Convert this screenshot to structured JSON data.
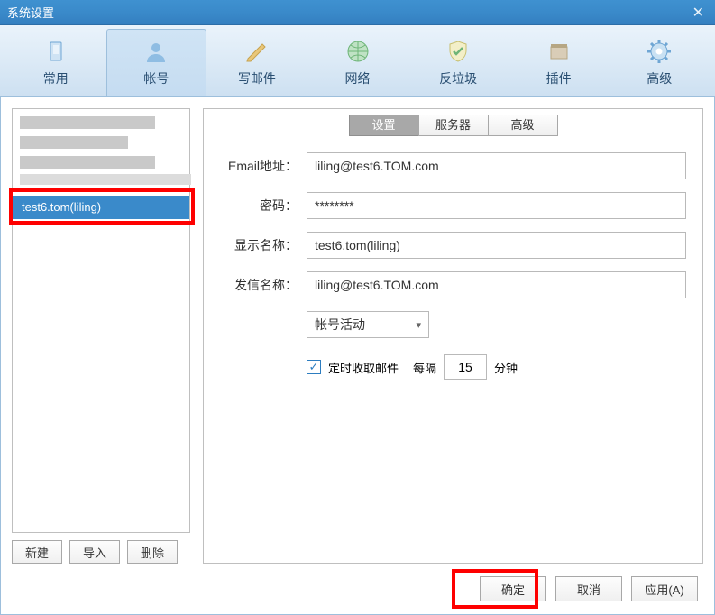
{
  "window": {
    "title": "系统设置"
  },
  "toolbar": {
    "items": [
      {
        "label": "常用",
        "name": "tab-general",
        "active": false
      },
      {
        "label": "帐号",
        "name": "tab-account",
        "active": true
      },
      {
        "label": "写邮件",
        "name": "tab-compose",
        "active": false
      },
      {
        "label": "网络",
        "name": "tab-network",
        "active": false
      },
      {
        "label": "反垃圾",
        "name": "tab-antispam",
        "active": false
      },
      {
        "label": "插件",
        "name": "tab-plugin",
        "active": false
      },
      {
        "label": "高级",
        "name": "tab-advanced",
        "active": false
      }
    ]
  },
  "accounts": {
    "selected_label": "test6.tom(liling)",
    "buttons": {
      "new": "新建",
      "import": "导入",
      "delete": "删除"
    }
  },
  "subtabs": {
    "items": [
      {
        "label": "设置",
        "name": "subtab-settings",
        "active": true
      },
      {
        "label": "服务器",
        "name": "subtab-server",
        "active": false
      },
      {
        "label": "高级",
        "name": "subtab-advanced",
        "active": false
      }
    ]
  },
  "form": {
    "email_label": "Email地址：",
    "email_value": "liling@test6.TOM.com",
    "pwd_label": "密码：",
    "pwd_value": "********",
    "display_label": "显示名称：",
    "display_value": "test6.tom(liling)",
    "sender_label": "发信名称：",
    "sender_value": "liling@test6.TOM.com",
    "status_select": "帐号活动",
    "poll_checkbox_label": "定时收取邮件",
    "poll_every_label": "每隔",
    "poll_minutes_value": "15",
    "poll_unit_label": "分钟"
  },
  "dialog_buttons": {
    "ok": "确定",
    "cancel": "取消",
    "apply": "应用(A)"
  },
  "annotation": {
    "highlight_color": "#fe0000"
  }
}
